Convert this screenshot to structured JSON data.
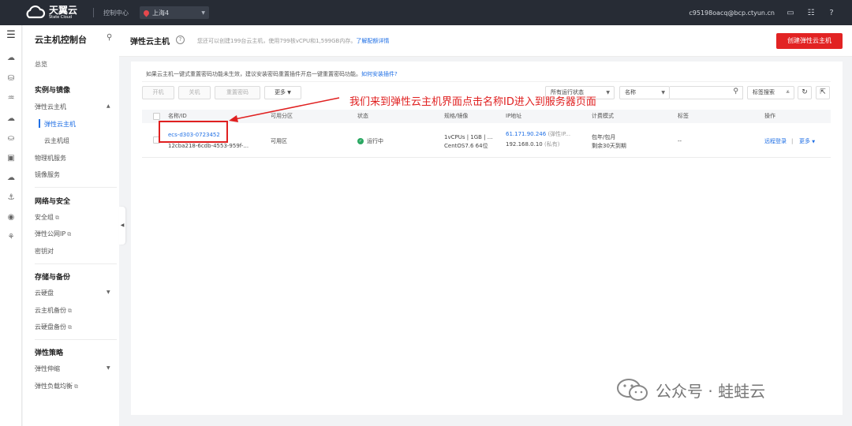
{
  "topbar": {
    "logo_cn": "天翼云",
    "logo_en": "State Cloud",
    "console": "控制中心",
    "region": "上海4",
    "account": "c95198oacq@bcp.ctyun.cn",
    "icons": [
      "message-icon",
      "settings-icon",
      "help-icon"
    ]
  },
  "sidebar": {
    "title": "云主机控制台",
    "overview": "总览",
    "group_instances": "实例与镜像",
    "ecs": "弹性云主机",
    "ecs_sub": "弹性云主机",
    "ecs_group": "云主机组",
    "bms": "物理机服务",
    "images": "镜像服务",
    "group_network": "网络与安全",
    "security_group": "安全组",
    "eip": "弹性公网IP",
    "keypair": "密钥对",
    "group_storage": "存储与备份",
    "disk": "云硬盘",
    "ecs_backup": "云主机备份",
    "disk_backup": "云硬盘备份",
    "group_policy": "弹性策略",
    "autoscale": "弹性伸缩",
    "elb": "弹性负载均衡"
  },
  "header": {
    "title": "弹性云主机",
    "quota": "您还可以创建199台云主机，使用799核vCPU和1,599GB内存。",
    "quota_link": "了解配额详情",
    "create": "创建弹性云主机"
  },
  "notice": {
    "text": "如果云主机一键式重置密码功能未生效，建议安装密码重置插件开启一键重置密码功能。",
    "link": "如何安装插件?"
  },
  "toolbar": {
    "start": "开机",
    "stop": "关机",
    "reset_pwd": "重置密码",
    "more": "更多",
    "status_filter": "所有运行状态",
    "name_filter": "名称",
    "search_placeholder": "",
    "tag_search": "标签搜索"
  },
  "table": {
    "headers": [
      "名称/ID",
      "可用分区",
      "状态",
      "规格/镜像",
      "IP地址",
      "计费模式",
      "标签",
      "操作"
    ],
    "rows": [
      {
        "name": "ecs-d303-0723452",
        "id": "12cba218-6cdb-4553-959f-...",
        "zone": "可用区",
        "status": "运行中",
        "spec": "1vCPUs | 1GB | ...",
        "image": "CentOS7.6 64位",
        "public_ip": "61.171.90.246",
        "public_ip_note": "(弹性IP...",
        "private_ip": "192.168.0.10",
        "private_ip_note": "(私有)",
        "billing": "包年/包月",
        "billing_remain": "剩余30天到期",
        "tags": "--",
        "action_remote": "远程登录",
        "action_more": "更多"
      }
    ]
  },
  "annotation": {
    "text": "我们来到弹性云主机界面点击名称ID进入到服务器页面"
  },
  "watermark": {
    "text": "公众号 · 蛙蛙云"
  },
  "colors": {
    "topbar": "#272c35",
    "primary_red": "#e22323",
    "link_blue": "#1f6fe5",
    "annotation_red": "#e02020",
    "running_green": "#2aa862"
  }
}
